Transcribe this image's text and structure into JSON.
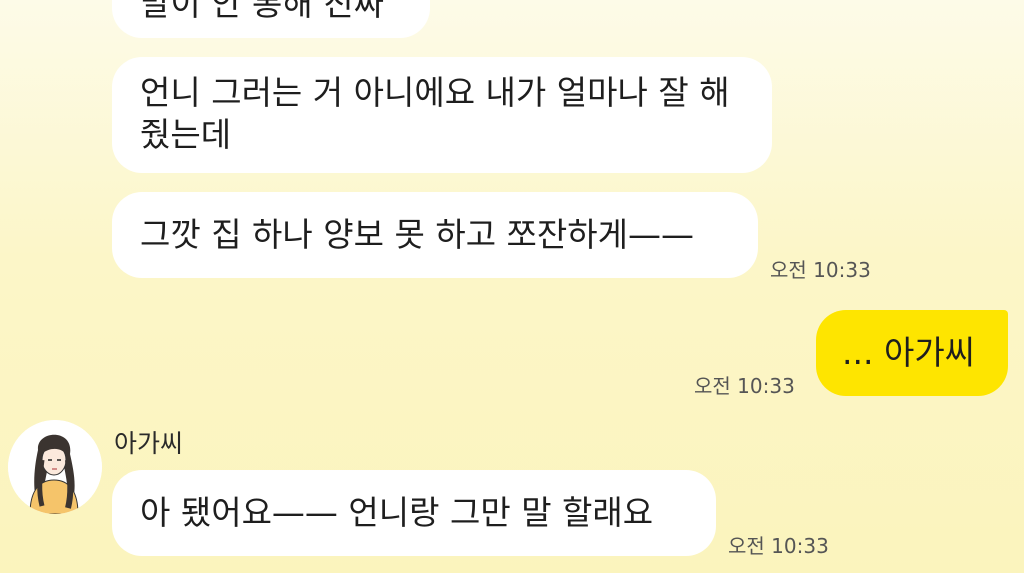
{
  "messages": [
    {
      "text": "말이 안 통해 진짜",
      "side": "left"
    },
    {
      "text": "언니 그러는 거 아니에요 내가 얼마나 잘 해줬는데",
      "side": "left"
    },
    {
      "text": "그깟 집 하나 양보 못 하고 쪼잔하게——",
      "side": "left",
      "time": "오전 10:33"
    },
    {
      "text": "... 아가씨",
      "side": "right",
      "time": "오전 10:33"
    },
    {
      "text": "아 됐어요—— 언니랑 그만 말 할래요",
      "side": "left",
      "sender": "아가씨",
      "time": "오전 10:33"
    }
  ],
  "colors": {
    "my_bubble": "#fee500",
    "other_bubble": "#ffffff",
    "background": "#fcf6c8"
  },
  "icons": {
    "avatar": "woman-portrait-avatar"
  }
}
